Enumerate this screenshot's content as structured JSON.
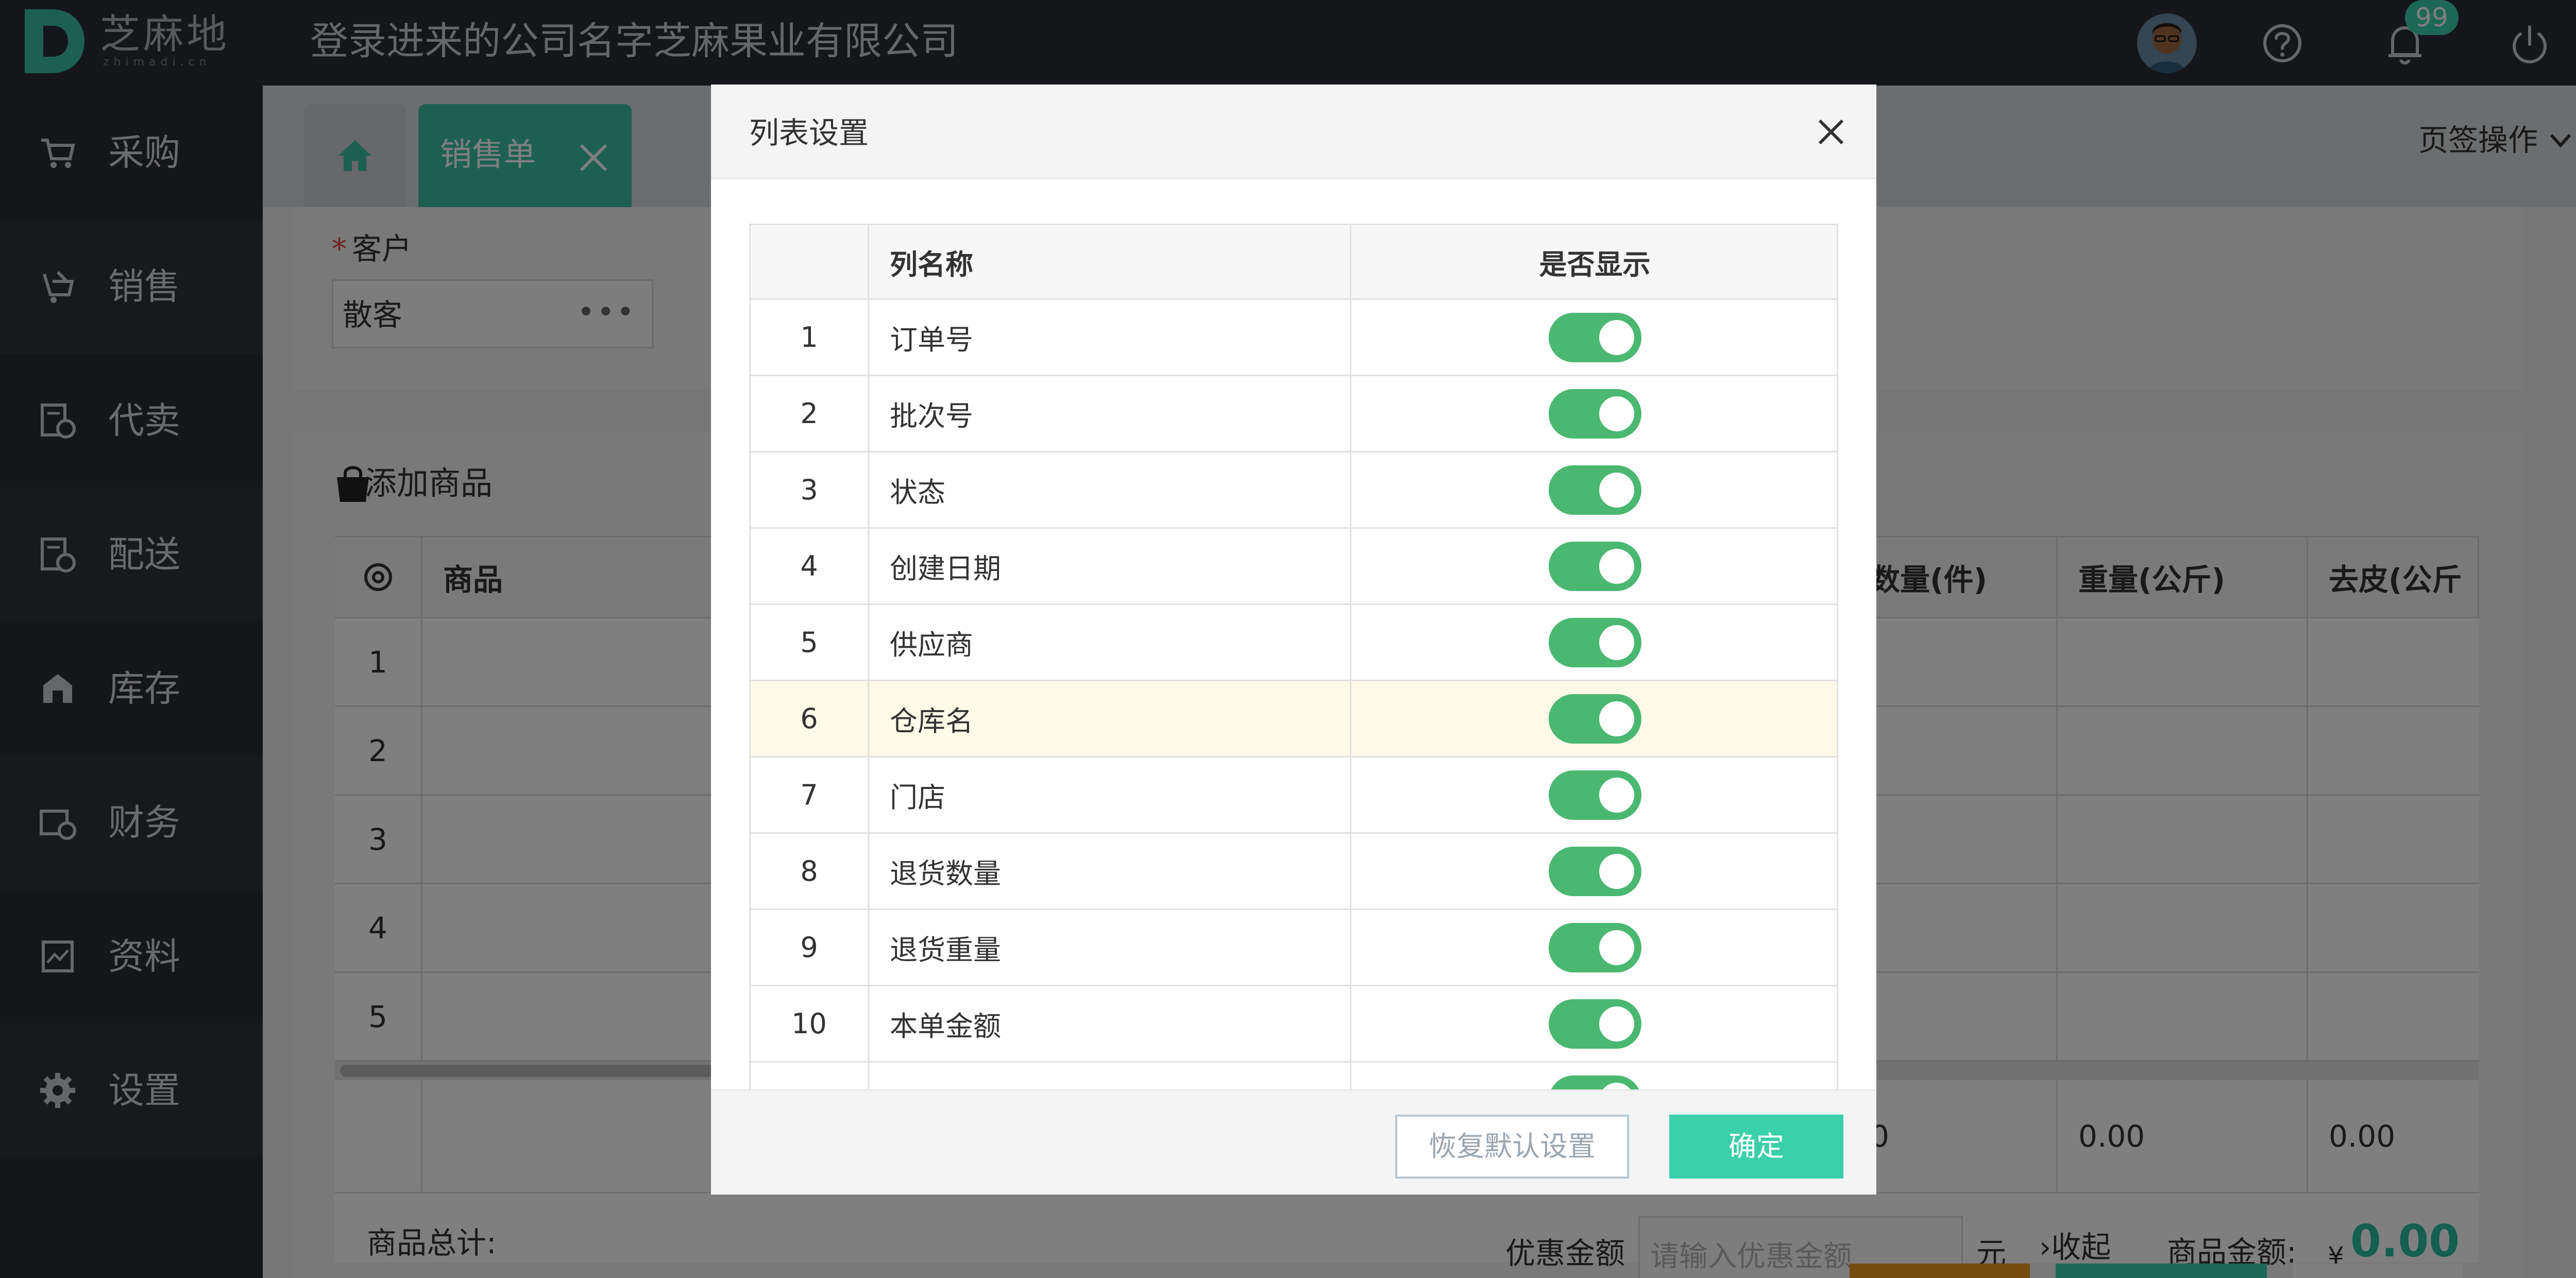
{
  "app": {
    "logo_cn": "芝麻地",
    "logo_en": "zhimadi.cn",
    "company": "登录进来的公司名字芝麻果业有限公司",
    "notification_count": "99",
    "accent": "#3ad0aa"
  },
  "sidebar": {
    "items": [
      {
        "label": "采购",
        "icon": "cart-icon"
      },
      {
        "label": "销售",
        "icon": "sale-icon"
      },
      {
        "label": "代卖",
        "icon": "consign-icon"
      },
      {
        "label": "配送",
        "icon": "delivery-icon"
      },
      {
        "label": "库存",
        "icon": "warehouse-icon"
      },
      {
        "label": "财务",
        "icon": "finance-icon"
      },
      {
        "label": "资料",
        "icon": "archive-icon"
      },
      {
        "label": "设置",
        "icon": "gear-icon"
      }
    ]
  },
  "tabs": {
    "active_label": "销售单",
    "page_ops": "页签操作"
  },
  "form": {
    "customer_label": "客户",
    "customer_value": "散客",
    "add_goods_title": "添加商品"
  },
  "grid": {
    "headers": [
      "商品",
      "数量(件)",
      "重量(公斤)",
      "去皮(公斤"
    ],
    "row_numbers": [
      "1",
      "2",
      "3",
      "4",
      "5"
    ],
    "totals": [
      "0",
      "0.00",
      "0.00"
    ]
  },
  "summary": {
    "total_label": "商品总计:",
    "discount_label": "优惠金额",
    "discount_placeholder": "请输入优惠金额",
    "yuan": "元",
    "collapse": "收起",
    "amount_label": "商品金额:",
    "currency": "¥",
    "amount_value": "0.00"
  },
  "modal": {
    "title": "列表设置",
    "col_name_header": "列名称",
    "col_show_header": "是否显示",
    "rows": [
      {
        "idx": "1",
        "name": "订单号",
        "show": true
      },
      {
        "idx": "2",
        "name": "批次号",
        "show": true
      },
      {
        "idx": "3",
        "name": "状态",
        "show": true
      },
      {
        "idx": "4",
        "name": "创建日期",
        "show": true
      },
      {
        "idx": "5",
        "name": "供应商",
        "show": true
      },
      {
        "idx": "6",
        "name": "仓库名",
        "show": true
      },
      {
        "idx": "7",
        "name": "门店",
        "show": true
      },
      {
        "idx": "8",
        "name": "退货数量",
        "show": true
      },
      {
        "idx": "9",
        "name": "退货重量",
        "show": true
      },
      {
        "idx": "10",
        "name": "本单金额",
        "show": true
      },
      {
        "idx": "",
        "name": "",
        "show": true
      }
    ],
    "reset_label": "恢复默认设置",
    "ok_label": "确定"
  }
}
